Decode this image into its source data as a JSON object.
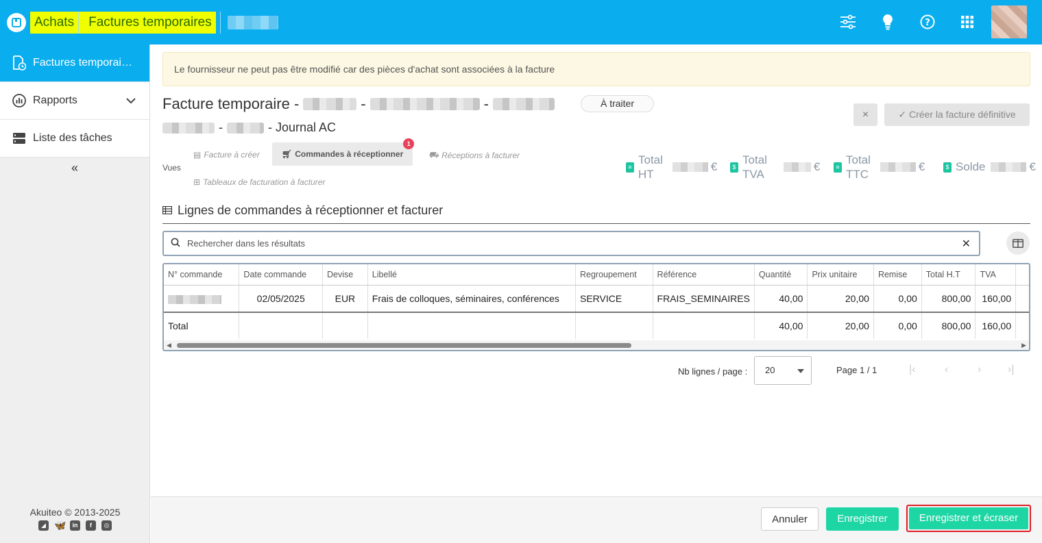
{
  "topbar": {
    "crumb_1": "Achats",
    "crumb_2": "Factures temporaires",
    "icons": [
      "sliders-icon",
      "lightbulb-icon",
      "help-icon",
      "apps-grid-icon"
    ]
  },
  "sidebar": {
    "items": [
      {
        "label": "Factures temporai…",
        "icon": "invoice-clock-icon",
        "active": true
      },
      {
        "label": "Rapports",
        "icon": "report-chart-icon"
      },
      {
        "label": "Liste des tâches",
        "icon": "task-list-icon"
      }
    ],
    "collapse": "«",
    "copyright": "Akuiteo © 2013-2025"
  },
  "alert": {
    "text": "Le fournisseur ne peut pas être modifié car des pièces d'achat sont associées à la facture"
  },
  "invoice": {
    "title_prefix": "Facture temporaire -",
    "dash": "-",
    "journal": "- Journal AC",
    "status": "À traiter",
    "create_final_label": "✓ Créer la facture définitive",
    "close_label": "×"
  },
  "views": {
    "label": "Vues",
    "tabs": [
      {
        "label": "Facture à créer"
      },
      {
        "label": "Commandes à réceptionner",
        "badge": "1",
        "active": true
      },
      {
        "label": "Réceptions à facturer"
      },
      {
        "label": "Tableaux de facturation à facturer"
      }
    ]
  },
  "totals": [
    {
      "label_1": "Total",
      "label_2": "HT",
      "currency": "€"
    },
    {
      "label_1": "Total",
      "label_2": "TVA",
      "currency": "€"
    },
    {
      "label_1": "Total",
      "label_2": "TTC",
      "currency": "€"
    },
    {
      "label_1": "Solde",
      "label_2": "",
      "currency": "€"
    }
  ],
  "section": {
    "title": "Lignes de commandes à réceptionner et facturer"
  },
  "search": {
    "placeholder": "Rechercher dans les résultats"
  },
  "table": {
    "headers": [
      "N° commande",
      "Date commande",
      "Devise",
      "Libellé",
      "Regroupement",
      "Référence",
      "Quantité",
      "Prix unitaire",
      "Remise",
      "Total H.T",
      "TVA"
    ],
    "row": {
      "date": "02/05/2025",
      "currency": "EUR",
      "label": "Frais de colloques, séminaires, conférences",
      "group": "SERVICE",
      "reference": "FRAIS_SEMINAIRES",
      "qty": "40,00",
      "unit_price": "20,00",
      "discount": "0,00",
      "total_ht": "800,00",
      "tva": "160,00"
    },
    "total": {
      "label": "Total",
      "qty": "40,00",
      "unit_price": "20,00",
      "discount": "0,00",
      "total_ht": "800,00",
      "tva": "160,00"
    }
  },
  "pager": {
    "rows_label": "Nb lignes / page :",
    "rows_value": "20",
    "page_label": "Page 1 / 1"
  },
  "footer": {
    "cancel": "Annuler",
    "save": "Enregistrer",
    "save_overwrite": "Enregistrer et écraser"
  },
  "colors": {
    "primary": "#0aaeef",
    "accent": "#1dd6a4",
    "highlight": "#f0ff00",
    "danger": "#e01b24"
  }
}
